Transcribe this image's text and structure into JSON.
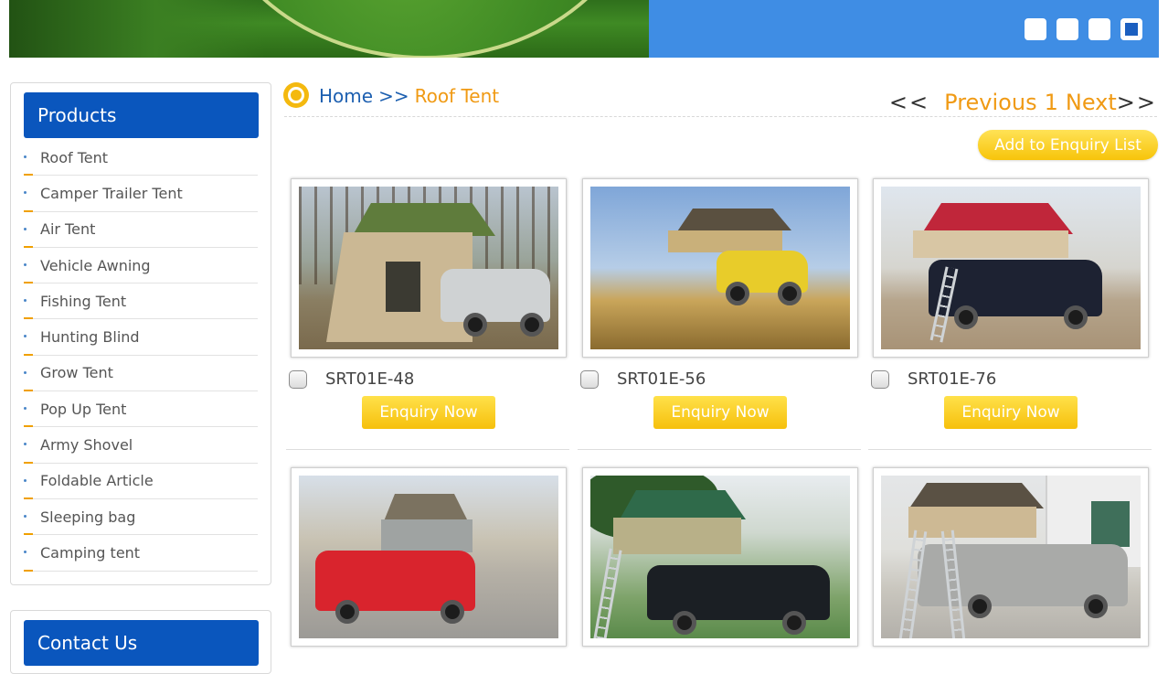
{
  "banner": {
    "slides": [
      "1",
      "2",
      "3",
      "4"
    ],
    "active_slide": 4
  },
  "sidebar": {
    "products_title": "Products",
    "categories": [
      "Roof Tent",
      "Camper Trailer Tent",
      "Air Tent",
      "Vehicle Awning",
      "Fishing Tent",
      "Hunting Blind",
      "Grow Tent",
      "Pop Up Tent",
      "Army Shovel",
      "Foldable Article",
      "Sleeping bag",
      "Camping tent"
    ],
    "contact_title": "Contact Us"
  },
  "breadcrumb": {
    "home": "Home",
    "separator": ">>",
    "current": "Roof Tent"
  },
  "pager": {
    "prev_arrow": "<<",
    "previous": "Previous",
    "page": "1",
    "next": "Next",
    "next_arrow": ">>"
  },
  "add_to_enquiry_label": "Add to Enquiry List",
  "products": [
    {
      "code": "SRT01E-48",
      "button": "Enquiry Now"
    },
    {
      "code": "SRT01E-56",
      "button": "Enquiry Now"
    },
    {
      "code": "SRT01E-76",
      "button": "Enquiry Now"
    }
  ],
  "colors": {
    "accent_blue": "#0a56bd",
    "accent_orange": "#f09a14",
    "button_yellow": "#f6c00c"
  }
}
